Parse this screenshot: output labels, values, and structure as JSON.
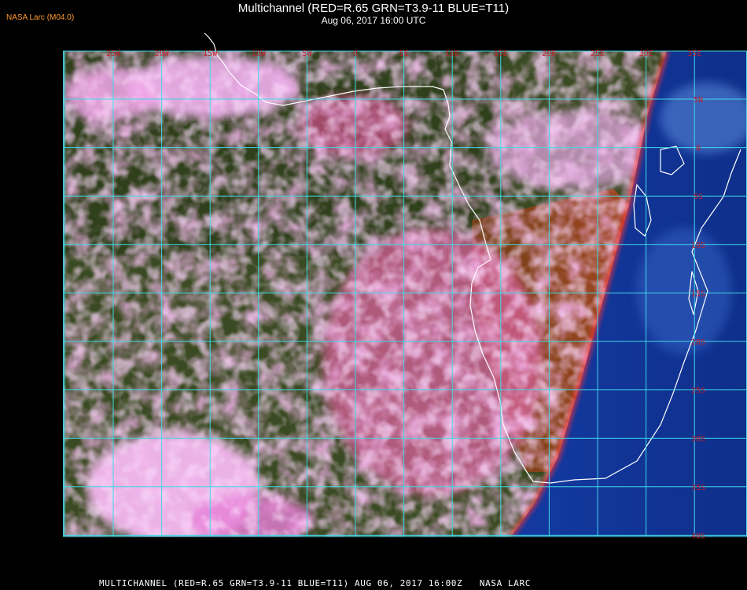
{
  "header": {
    "title": "Multichannel (RED=R.65 GRN=T3.9-11 BLUE=T11)",
    "datetime": "Aug 06, 2017 16:00 UTC",
    "brand": "NASA Larc (M04.0)"
  },
  "footer": {
    "caption": "MULTICHANNEL (RED=R.65 GRN=T3.9-11 BLUE=T11) AUG 06, 2017 16:00Z   NASA LARC"
  },
  "map": {
    "longitude_labels": [
      "25W",
      "20W",
      "15W",
      "10W",
      "5W",
      "0",
      "5E",
      "10E",
      "15E",
      "20E",
      "25E",
      "30E",
      "35E"
    ],
    "latitude_labels": [
      "5N",
      "0",
      "5S",
      "10S",
      "15S",
      "20S",
      "25S",
      "30S",
      "35S",
      "40S"
    ],
    "colors": {
      "grid": "#3fd8e8",
      "label": "#c0202a",
      "coast": "#ffffff",
      "ocean": "#3a4a22",
      "cloud": "#e070d0",
      "land_dry": "#6a3a14",
      "night_side": "#1848b0"
    },
    "channel_legend": {
      "red": "R.65",
      "green": "T3.9-11",
      "blue": "T11"
    }
  }
}
